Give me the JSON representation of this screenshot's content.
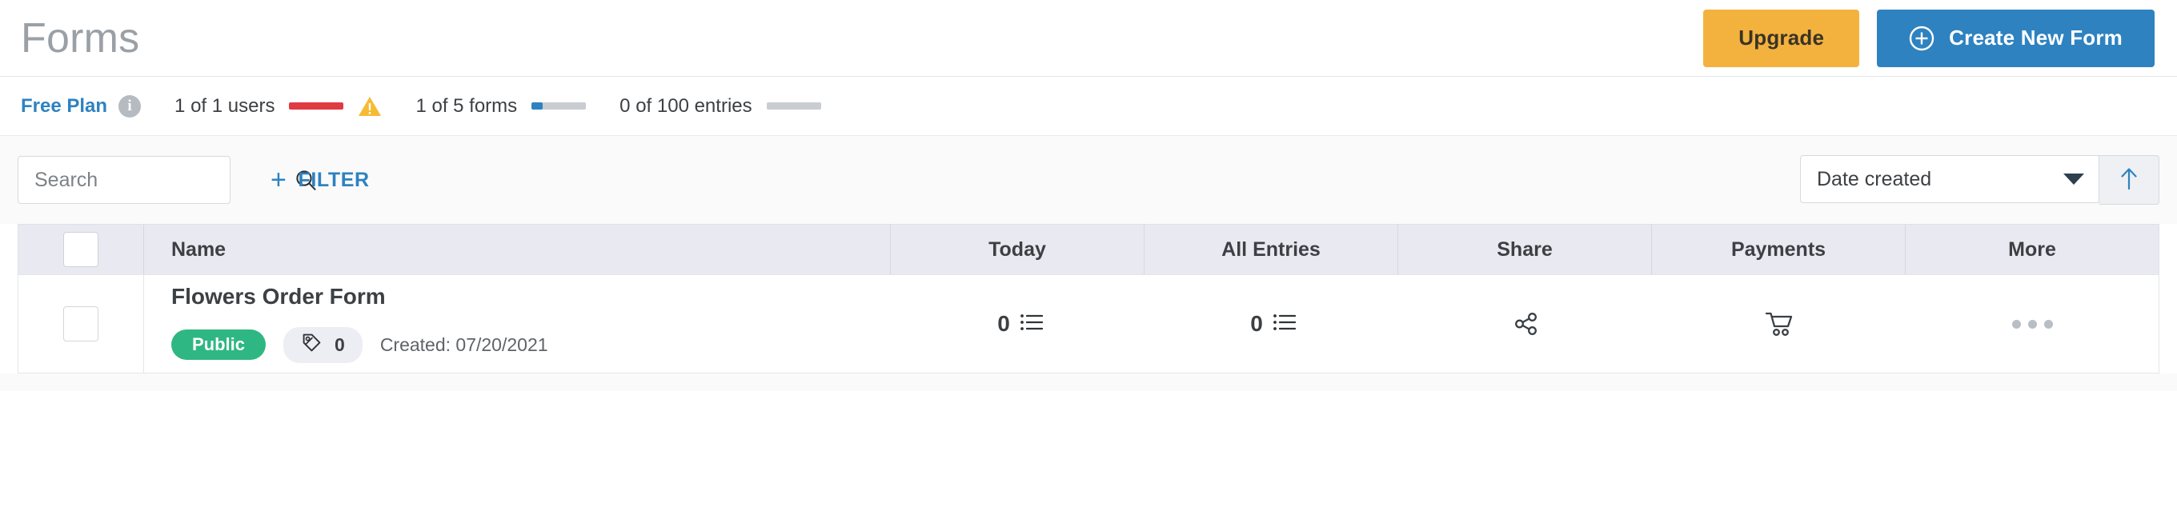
{
  "header": {
    "title": "Forms",
    "upgrade_label": "Upgrade",
    "create_label": "Create New Form",
    "upgrade_color": "#f3b23e",
    "create_color": "#2e82c0"
  },
  "plan_bar": {
    "plan_label": "Free Plan",
    "plan_link_color": "#2e82c0",
    "info_glyph": "i",
    "usages": [
      {
        "label": "1 of 1 users",
        "percent": 100,
        "color": "#e03b43",
        "warning": true
      },
      {
        "label": "1 of 5 forms",
        "percent": 20,
        "color": "#2e82c0",
        "warning": false
      },
      {
        "label": "0 of 100 entries",
        "percent": 0,
        "color": "#c9ccd1",
        "warning": false
      }
    ]
  },
  "toolbar": {
    "search_placeholder": "Search",
    "search_value": "",
    "filter_label": "FILTER",
    "filter_plus": "+",
    "sort_value": "Date created",
    "sort_direction": "ascending"
  },
  "table": {
    "columns": [
      {
        "key": "name",
        "label": "Name"
      },
      {
        "key": "today",
        "label": "Today"
      },
      {
        "key": "all_entries",
        "label": "All Entries"
      },
      {
        "key": "share",
        "label": "Share"
      },
      {
        "key": "payments",
        "label": "Payments"
      },
      {
        "key": "more",
        "label": "More"
      }
    ],
    "rows": [
      {
        "name": "Flowers Order Form",
        "status": "Public",
        "status_color": "#2fb783",
        "tag_count": "0",
        "created": "Created: 07/20/2021",
        "today": "0",
        "all_entries": "0",
        "share_icon": "share-icon",
        "payments_icon": "shopping-cart-icon",
        "more_icon": "ellipsis-icon"
      }
    ]
  }
}
